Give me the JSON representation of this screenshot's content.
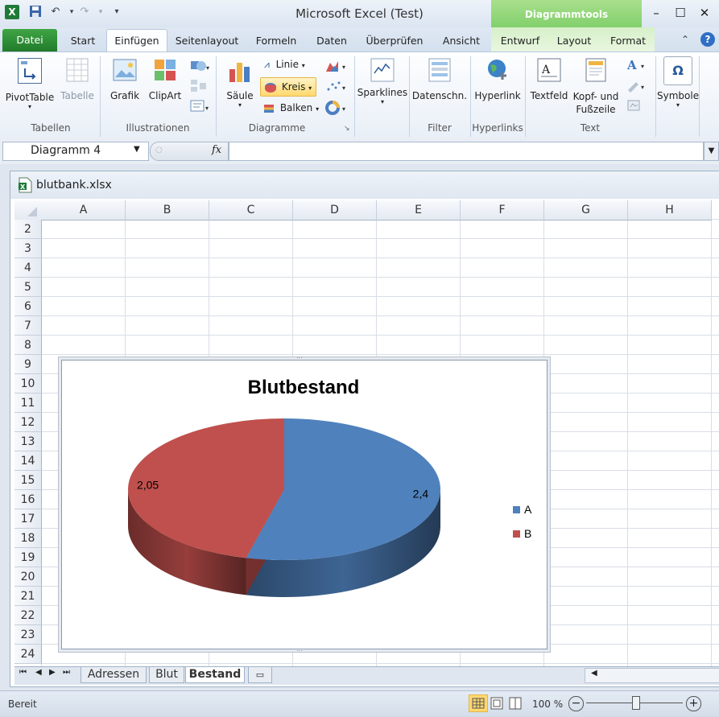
{
  "window": {
    "title": "Microsoft Excel (Test)",
    "context_tab_group": "Diagrammtools"
  },
  "tabs": {
    "file": "Datei",
    "items": [
      "Start",
      "Einfügen",
      "Seitenlayout",
      "Formeln",
      "Daten",
      "Überprüfen",
      "Ansicht"
    ],
    "context_items": [
      "Entwurf",
      "Layout",
      "Format"
    ],
    "active": "Einfügen"
  },
  "ribbon": {
    "groups": {
      "tables": "Tabellen",
      "illustrations": "Illustrationen",
      "charts": "Diagramme",
      "filter": "Filter",
      "hyperlinks": "Hyperlinks",
      "text": "Text"
    },
    "buttons": {
      "pivottable": "PivotTable",
      "table": "Tabelle",
      "picture": "Grafik",
      "clipart": "ClipArt",
      "column": "Säule",
      "line": "Linie",
      "pie": "Kreis",
      "bar": "Balken",
      "sparklines": "Sparklines",
      "slicer": "Datenschn.",
      "hyperlink": "Hyperlink",
      "textbox": "Textfeld",
      "header_footer_1": "Kopf- und",
      "header_footer_2": "Fußzeile",
      "symbols": "Symbole"
    }
  },
  "formula_bar": {
    "name_box": "Diagramm 4",
    "fx": "fx",
    "formula": ""
  },
  "workbook": {
    "filename": "blutbank.xlsx",
    "columns": [
      "A",
      "B",
      "C",
      "D",
      "E",
      "F",
      "G",
      "H"
    ],
    "rows": [
      "2",
      "3",
      "4",
      "5",
      "6",
      "7",
      "8",
      "9",
      "10",
      "11",
      "12",
      "13",
      "14",
      "15",
      "16",
      "17",
      "18",
      "19",
      "20",
      "21",
      "22",
      "23",
      "24"
    ],
    "sheets": [
      "Adressen",
      "Blut",
      "Bestand"
    ],
    "active_sheet": "Bestand"
  },
  "status_bar": {
    "status": "Bereit",
    "zoom": "100 %"
  },
  "chart_data": {
    "type": "pie",
    "title": "Blutbestand",
    "categories": [
      "A",
      "B"
    ],
    "values": [
      2.4,
      2.05
    ],
    "data_labels": [
      "2,4",
      "2,05"
    ],
    "colors": [
      "#4f81bd",
      "#c0504d"
    ],
    "legend_position": "right",
    "style": "3d"
  }
}
